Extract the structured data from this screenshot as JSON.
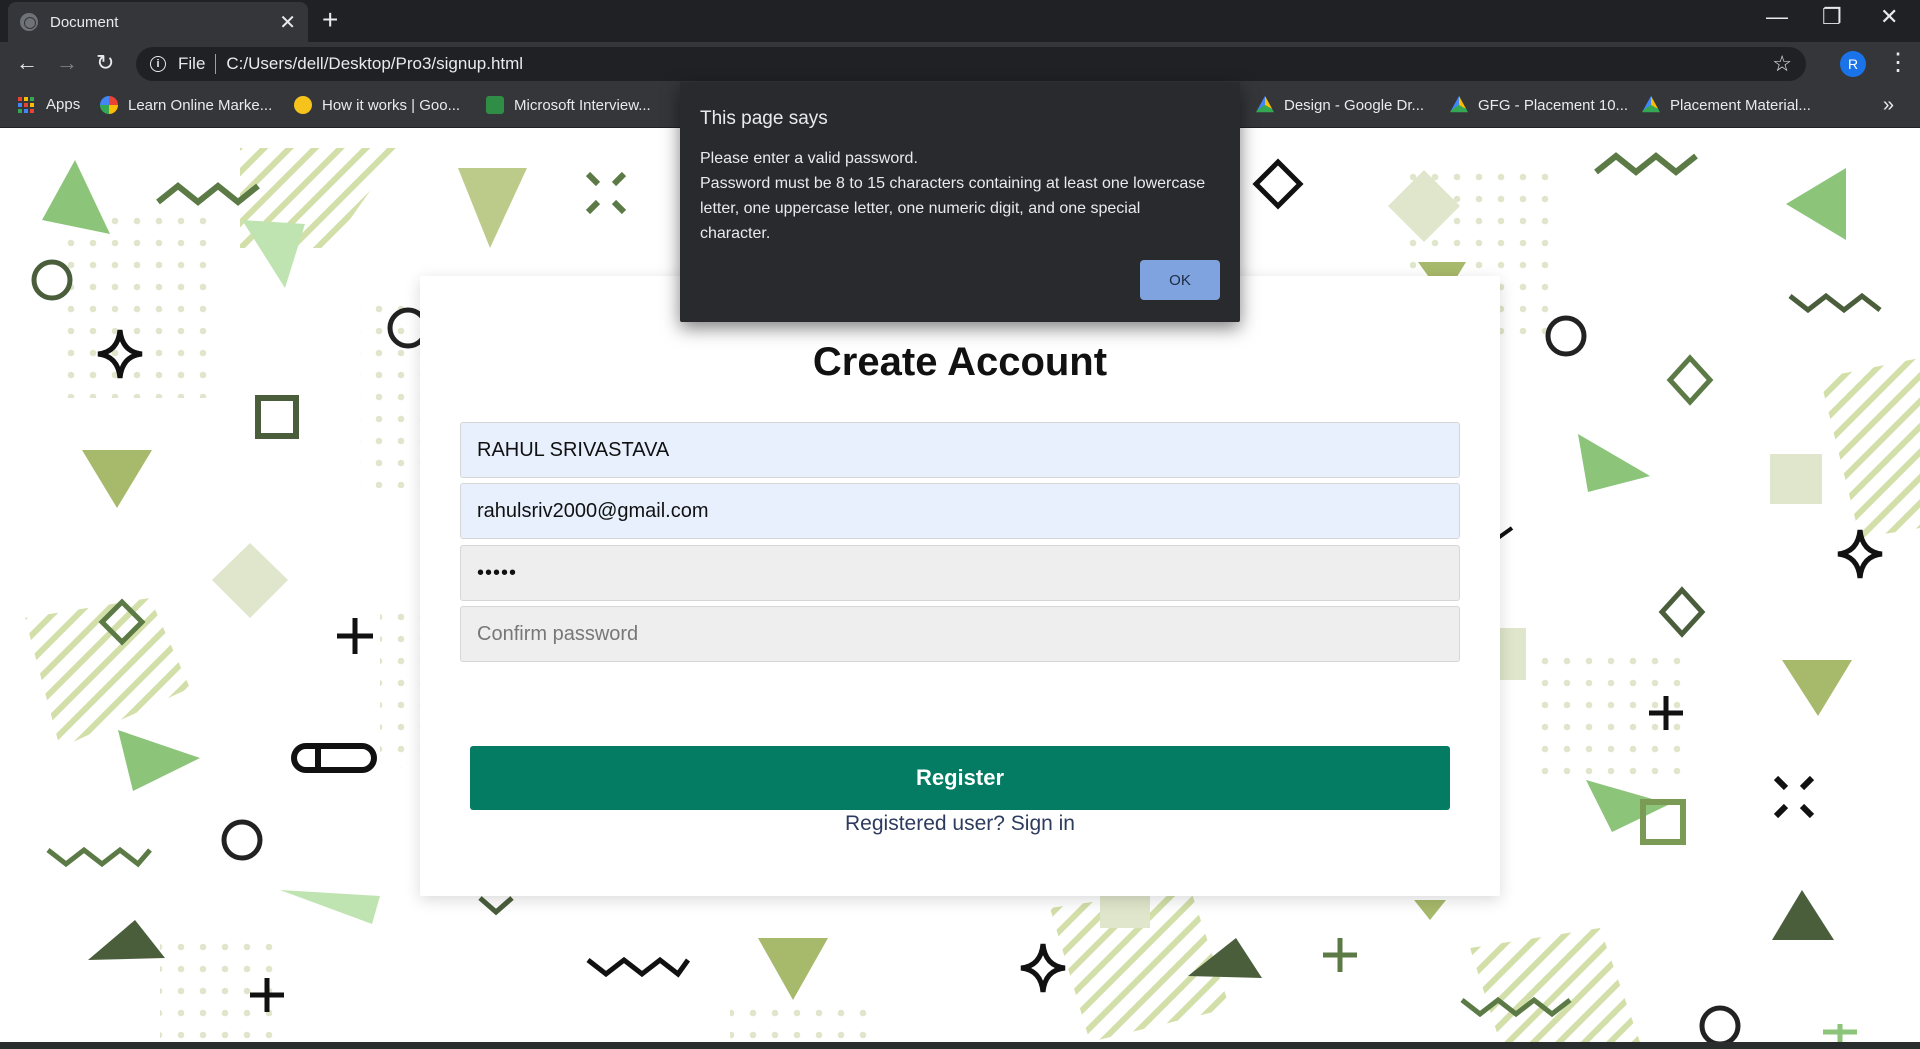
{
  "browser": {
    "tab_title": "Document",
    "tab_close": "✕",
    "new_tab": "+",
    "window_controls": {
      "minimize": "—",
      "restore": "❐",
      "close": "✕"
    },
    "address": {
      "scheme_label": "File",
      "url": "C:/Users/dell/Desktop/Pro3/signup.html"
    },
    "profile_initial": "R",
    "bookmarks": [
      {
        "label": "Apps",
        "icon": "apps-grid-icon"
      },
      {
        "label": "Learn Online Marke...",
        "icon": "google-icon"
      },
      {
        "label": "How it works | Goo...",
        "icon": "sun-icon"
      },
      {
        "label": "Microsoft Interview...",
        "icon": "gfg-icon"
      },
      {
        "label": "Design - Google Dr...",
        "icon": "drive-icon"
      },
      {
        "label": "GFG - Placement 10...",
        "icon": "drive-icon"
      },
      {
        "label": "Placement Material...",
        "icon": "drive-icon"
      }
    ],
    "more_bookmarks": "»"
  },
  "form": {
    "title": "Create Account",
    "name_value": "RAHUL SRIVASTAVA",
    "email_value": "rahulsriv2000@gmail.com",
    "password_value": "•••••",
    "confirm_placeholder": "Confirm password",
    "register_label": "Register",
    "signin_prefix": "Registered user? ",
    "signin_link": "Sign in"
  },
  "dialog": {
    "title": "This page says",
    "lines": [
      "Please enter a valid password.",
      "Password must be 8 to 15 characters containing at least one lowercase",
      "letter, one uppercase letter, one numeric digit, and one special",
      "character."
    ],
    "ok_label": "OK"
  },
  "colors": {
    "accent_green": "#037c63",
    "dialog_bg": "#292a2d",
    "ok_button": "#7fa3de",
    "decor_light": "#c8d99a",
    "decor_mid": "#8cc47a",
    "decor_dark": "#4a5e3c"
  }
}
